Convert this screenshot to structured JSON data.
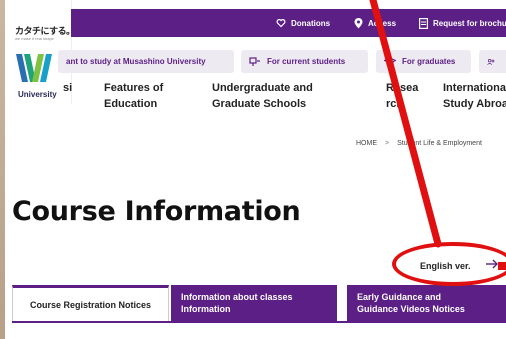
{
  "logo": {
    "tagline": "カタチにする。",
    "sub": "we make it real shape",
    "univ": "University"
  },
  "topbar": {
    "donations": "Donations",
    "access": "Access",
    "brochure": "Request for brochu"
  },
  "pills": {
    "study": "ant to study at Musashino University",
    "current": "For current students",
    "graduates": "For graduates"
  },
  "nav": {
    "item1": "si",
    "item2a": "Features of",
    "item2b": "Education",
    "item3a": "Undergraduate and",
    "item3b": "Graduate Schools",
    "item4a": "Resea",
    "item4b": "rch",
    "item5a": "International",
    "item5b": "Study Abroa"
  },
  "breadcrumb": {
    "home": "HOME",
    "sep": ">",
    "current": "Student Life & Employment"
  },
  "page": {
    "title": "Course Information",
    "english": "English ver."
  },
  "tabs": {
    "t1": "Course Registration Notices",
    "t2a": "Information about classes",
    "t2b": "Information",
    "t3a": "Early Guidance and",
    "t3b": "Guidance Videos Notices"
  },
  "colors": {
    "brand": "#5b1f86",
    "annotation": "#e01010"
  }
}
